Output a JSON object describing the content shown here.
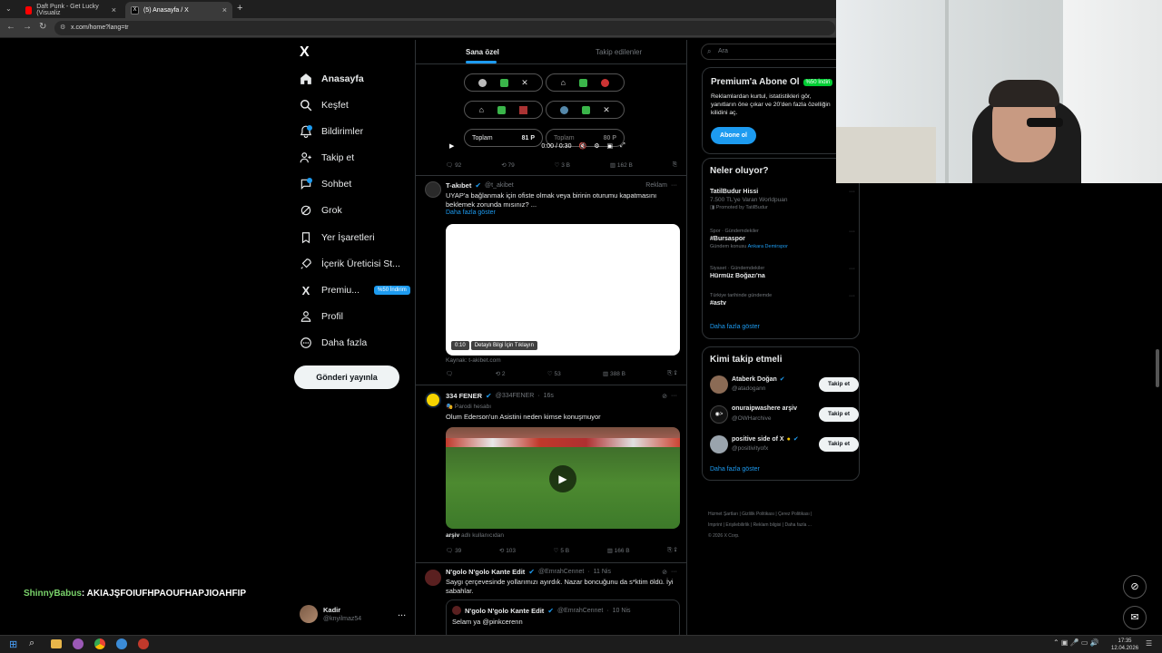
{
  "browser": {
    "tabs": [
      {
        "label": "Daft Punk - Get Lucky (Visualiz",
        "close": "×"
      },
      {
        "label": "(5) Anasayfa / X",
        "close": "×"
      }
    ],
    "new_tab": "+",
    "url": "x.com/home?lang=tr"
  },
  "sidebar": {
    "logo": "X",
    "items": [
      {
        "label": "Anasayfa"
      },
      {
        "label": "Keşfet"
      },
      {
        "label": "Bildirimler"
      },
      {
        "label": "Takip et"
      },
      {
        "label": "Sohbet"
      },
      {
        "label": "Grok"
      },
      {
        "label": "Yer İşaretleri"
      },
      {
        "label": "İçerik Üreticisi St..."
      },
      {
        "label": "Premiu...",
        "badge": "%50 İndirim"
      },
      {
        "label": "Profil"
      },
      {
        "label": "Daha fazla"
      }
    ],
    "post_button": "Gönderi yayınla",
    "account": {
      "name": "Kadir",
      "handle": "@knyilmaz54",
      "more": "..."
    }
  },
  "feed": {
    "tabs": [
      {
        "label": "Sana özel"
      },
      {
        "label": "Takip edilenler"
      }
    ],
    "embed": {
      "totals": [
        {
          "label": "Toplam",
          "value": "81 P"
        },
        {
          "label": "Toplam",
          "value": "80 P"
        }
      ],
      "time": "0:00 / 0:30"
    },
    "tweets": [
      {
        "actions": [
          "92",
          "79",
          "3 B",
          "162 B"
        ]
      },
      {
        "name": "T-akıbet",
        "handle": "@t_akibet",
        "tag": "Reklam",
        "text": "UYAP'a bağlanmak için ofiste olmak veya birinin oturumu kapatmasını beklemek zorunda mısınız? ...",
        "more": "Daha fazla göster",
        "video_time": "0:10",
        "video_cta": "Detaylı Bilgi İçin Tıklayın",
        "source": "Kaynak: t-akibet.com",
        "actions": [
          "",
          "2",
          "53",
          "388 B"
        ]
      },
      {
        "name": "334 FENER",
        "handle": "@334FENER",
        "time": "16s",
        "sub": "Parodi hesabı",
        "text": "Olum Ederson'un Asistini neden kimse konuşmuyor",
        "caption_user": "arşiv",
        "caption_rest": "adlı kullanıcıdan",
        "actions": [
          "39",
          "103",
          "5 B",
          "166 B"
        ]
      },
      {
        "name": "N'golo N'golo Kante Edit",
        "handle": "@EmrahCennet",
        "time": "11 Nis",
        "text": "Saygı çerçevesinde yollarımızı ayırdık. Nazar boncuğunu da s*ktim öldü. İyi sabahlar.",
        "quote_name": "N'golo N'golo Kante Edit",
        "quote_handle": "@EmrahCennet",
        "quote_time": "10 Nis",
        "quote_text": "Selam ya @pinkcerenn"
      }
    ]
  },
  "right": {
    "search_placeholder": "Ara",
    "premium": {
      "title": "Premium'a Abone Ol",
      "badge": "%50 İndiri",
      "text": "Reklamlardan kurtul, istatistikleri gör, yanıtların öne çıkar ve 20'den fazla özelliğin kilidini aç.",
      "button": "Abone ol"
    },
    "trends": {
      "title": "Neler oluyor?",
      "items": [
        {
          "title": "TatilBudur Hissi",
          "sub": "7.500 TL'ye Varan Worldpuan",
          "meta": "Promoted by TatilBudur"
        },
        {
          "context": "Spor · Gündemdekiler",
          "title": "#Bursaspor",
          "meta": "Gündem konusu",
          "meta_link": "Ankara Demirspor"
        },
        {
          "context": "Siyaset · Gündemdekiler",
          "title": "Hürmüz Boğazı'na"
        },
        {
          "context": "Türkiye tarihinde gündemde",
          "title": "#astv"
        }
      ],
      "more": "Daha fazla göster"
    },
    "who_to_follow": {
      "title": "Kimi takip etmeli",
      "users": [
        {
          "name": "Ataberk Doğan",
          "handle": "@atadogann",
          "button": "Takip et"
        },
        {
          "name": "onuraipwashere arşiv",
          "handle": "@OWHarchive",
          "button": "Takip et"
        },
        {
          "name": "positive side of X",
          "handle": "@positivityofx",
          "button": "Takip et"
        }
      ],
      "more": "Daha fazla göster"
    },
    "footer": [
      "Hizmet Şartları",
      "Gizlilik Politikası",
      "Çerez Politikası",
      "Imprint",
      "Erişilebilirlik",
      "Reklam bilgisi",
      "Daha fazla ...",
      "© 2026 X Corp."
    ]
  },
  "overlay": {
    "chat_user": "ShinnyBabus",
    "chat_text": ": AKIAJŞFOIUFHPAOUFHAPJIOAHFIP"
  },
  "taskbar": {
    "time": "17:35",
    "date": "12.04.2026"
  }
}
